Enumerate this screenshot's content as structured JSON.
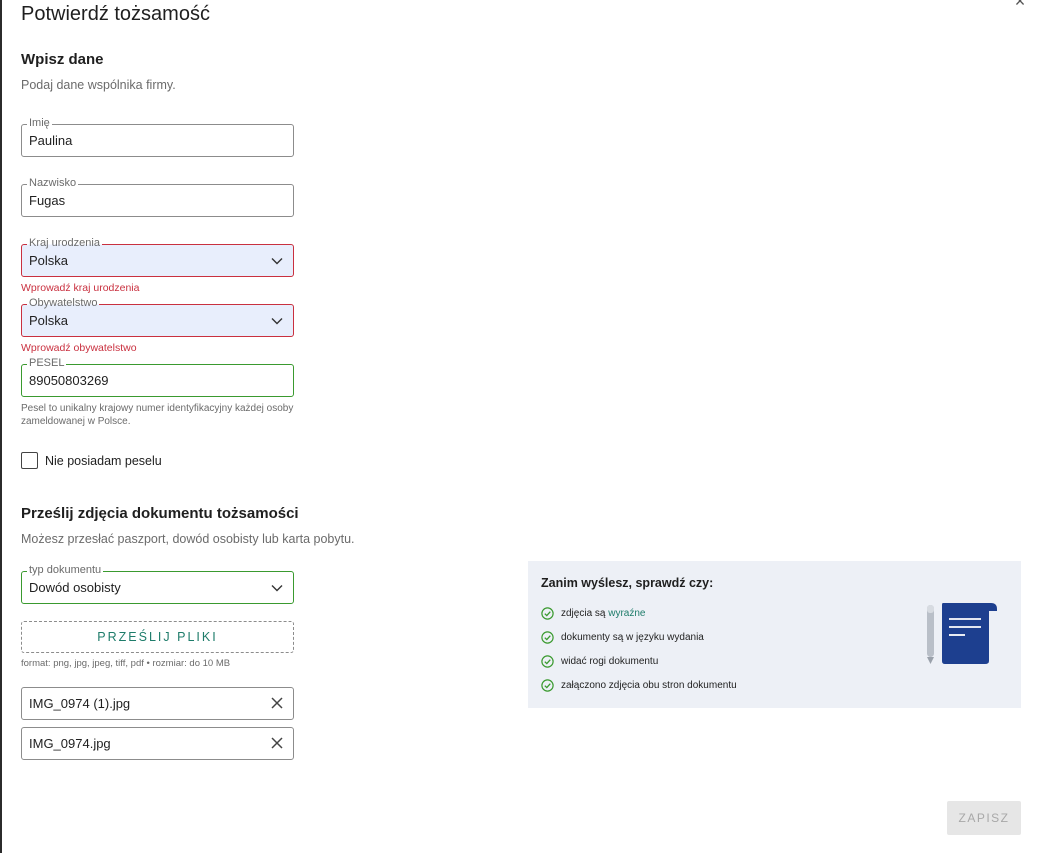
{
  "dialog": {
    "title": "Potwierdź tożsamość"
  },
  "personal": {
    "section_title": "Wpisz dane",
    "section_subtitle": "Podaj dane wspólnika firmy.",
    "first_name": {
      "label": "Imię",
      "value": "Paulina"
    },
    "last_name": {
      "label": "Nazwisko",
      "value": "Fugas"
    },
    "birth_country": {
      "label": "Kraj urodzenia",
      "value": "Polska",
      "error": "Wprowadź kraj urodzenia"
    },
    "citizenship": {
      "label": "Obywatelstwo",
      "value": "Polska",
      "error": "Wprowadź obywatelstwo"
    },
    "pesel": {
      "label": "PESEL",
      "value": "89050803269",
      "hint": "Pesel to unikalny krajowy numer identyfikacyjny każdej osoby zameldowanej w Polsce."
    },
    "no_pesel_label": "Nie posiadam peselu"
  },
  "document": {
    "section_title": "Prześlij zdjęcia dokumentu tożsamości",
    "section_subtitle": "Możesz przesłać paszport, dowód osobisty lub karta pobytu.",
    "doc_type": {
      "label": "typ dokumentu",
      "value": "Dowód osobisty"
    },
    "upload_label": "PRZEŚLIJ PLIKI",
    "format_hint": "format: png, jpg, jpeg, tiff, pdf • rozmiar: do 10 MB",
    "files": [
      "IMG_0974 (1).jpg",
      "IMG_0974.jpg"
    ]
  },
  "checklist": {
    "title": "Zanim wyślesz, sprawdź czy:",
    "items": [
      {
        "text": "zdjęcia są ",
        "accent": "wyraźne"
      },
      {
        "text": "dokumenty są w języku wydania",
        "accent": ""
      },
      {
        "text": "widać rogi dokumentu",
        "accent": ""
      },
      {
        "text": "załączono zdjęcia obu stron dokumentu",
        "accent": ""
      }
    ]
  },
  "footer": {
    "save_label": "ZAPISZ"
  },
  "colors": {
    "accent": "#1e7c6a",
    "error": "#c9303f",
    "valid": "#3a9a2f",
    "select_bg": "#e8eefc",
    "info_bg": "#edf0f6"
  }
}
